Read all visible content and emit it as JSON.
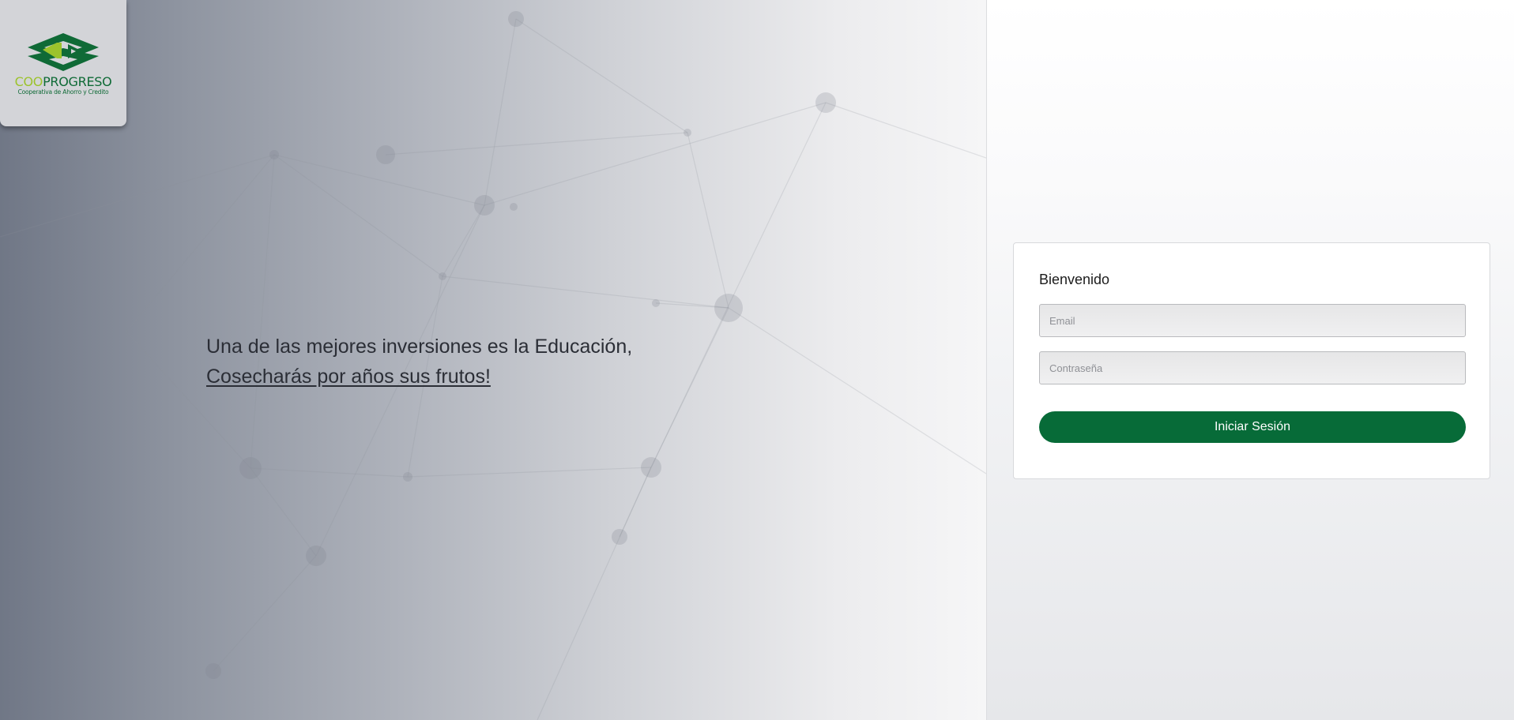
{
  "brand": {
    "name_part1": "COO",
    "name_part2": "PROGRESO",
    "subtitle": "Cooperativa de Ahorro y Credito",
    "colors": {
      "light_green": "#9cc32c",
      "dark_green": "#0f6a36"
    },
    "icon": "cooprogreso-logo-icon"
  },
  "hero": {
    "line1": "Una de las mejores inversiones es la Educación,",
    "line2": "Cosecharás por años sus frutos!"
  },
  "login": {
    "title": "Bienvenido",
    "email_placeholder": "Email",
    "password_placeholder": "Contraseña",
    "submit_label": "Iniciar Sesión",
    "button_color": "#076b38"
  }
}
